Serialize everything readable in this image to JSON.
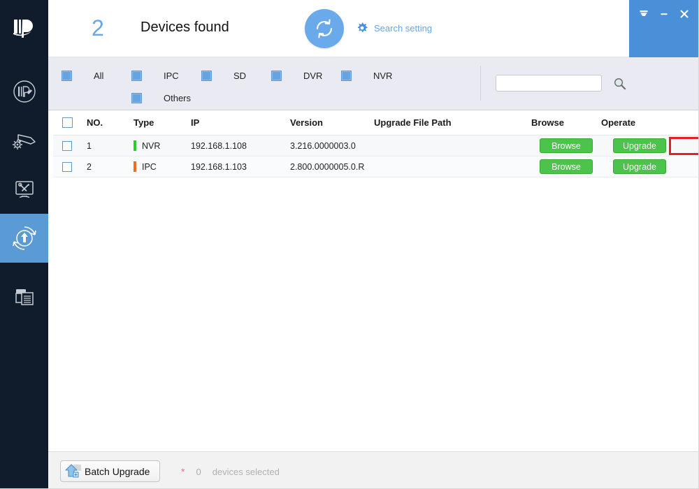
{
  "app": {
    "logo_alt": "ip-config-logo",
    "brand_dark": "#101c2b",
    "accent_blue": "#5b9bd5",
    "green_button": "#4cc44c",
    "highlight_red": "#e2202a"
  },
  "sidebar": {
    "items": [
      {
        "name": "modify-ip",
        "icon": "ip-circle-icon",
        "active": false
      },
      {
        "name": "device-config",
        "icon": "camera-gear-icon",
        "active": false
      },
      {
        "name": "system-tools",
        "icon": "monitor-tools-icon",
        "active": false
      },
      {
        "name": "device-upgrade",
        "icon": "upload-circle-icon",
        "active": true
      },
      {
        "name": "device-list",
        "icon": "documents-icon",
        "active": false
      }
    ]
  },
  "header": {
    "device_count": "2",
    "devices_found_label": "Devices found",
    "refresh_icon": "refresh-icon",
    "search_setting_label": "Search setting",
    "search_setting_icon": "gear-icon",
    "window_controls": [
      {
        "name": "tray-button",
        "icon": "tray-down-icon",
        "glyph": "tray"
      },
      {
        "name": "minimize-button",
        "icon": "minimize-icon",
        "glyph": "minimize"
      },
      {
        "name": "close-button",
        "icon": "close-icon",
        "glyph": "close"
      }
    ]
  },
  "filters": {
    "items": [
      {
        "label": "All",
        "checked": true
      },
      {
        "label": "IPC",
        "checked": true
      },
      {
        "label": "SD",
        "checked": true
      },
      {
        "label": "DVR",
        "checked": true
      },
      {
        "label": "NVR",
        "checked": true
      },
      {
        "label": "Others",
        "checked": true
      }
    ],
    "search": {
      "value": "",
      "placeholder": "",
      "icon": "search-icon"
    }
  },
  "table": {
    "columns": [
      "NO.",
      "Type",
      "IP",
      "Version",
      "Upgrade File Path",
      "Browse",
      "Operate"
    ],
    "header_checkbox_checked": false,
    "rows": [
      {
        "checked": false,
        "no": "1",
        "type": "NVR",
        "type_color": "#21d421",
        "ip": "192.168.1.108",
        "version": "3.216.0000003.0",
        "upgrade_file_path": "",
        "browse_label": "Browse",
        "operate_label": "Upgrade",
        "highlighted": true
      },
      {
        "checked": false,
        "no": "2",
        "type": "IPC",
        "type_color": "#f36d21",
        "ip": "192.168.1.103",
        "version": "2.800.0000005.0.R",
        "upgrade_file_path": "",
        "browse_label": "Browse",
        "operate_label": "Upgrade",
        "highlighted": false
      }
    ]
  },
  "footer": {
    "batch_upgrade_label": "Batch Upgrade",
    "batch_upgrade_icon": "upload-arrow-icon",
    "asterisk": "*",
    "selected_count": "0",
    "selected_text": "devices selected"
  }
}
